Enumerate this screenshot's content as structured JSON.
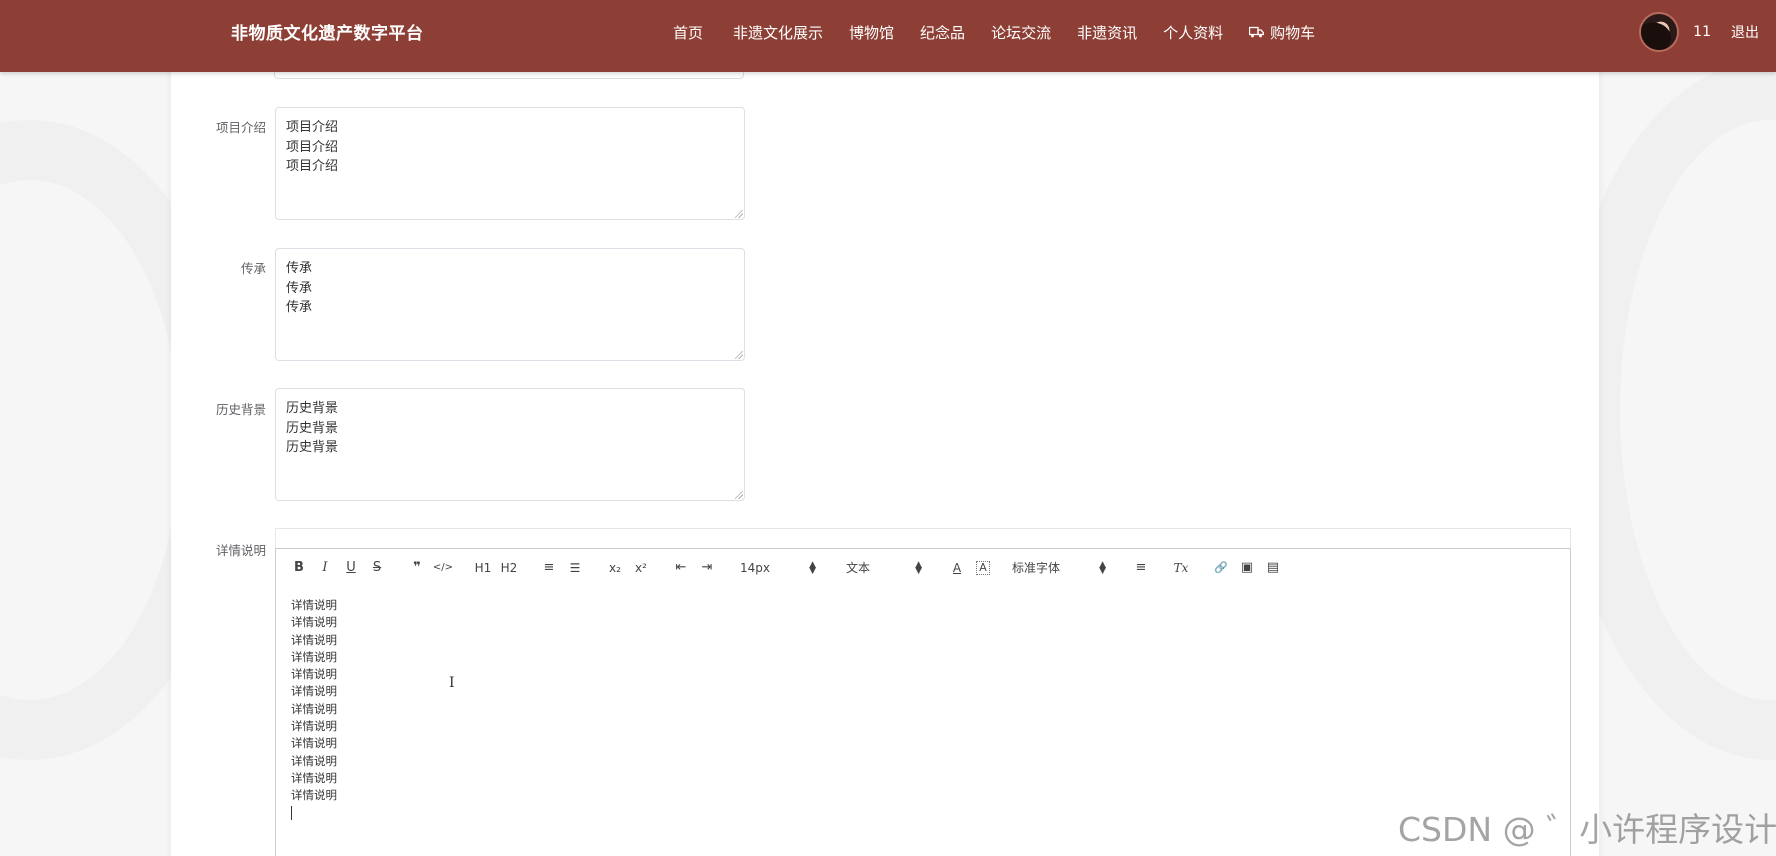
{
  "header": {
    "brand": "非物质文化遗产数字平台",
    "nav": [
      "首页",
      "非遗文化展示",
      "博物馆",
      "纪念品",
      "论坛交流",
      "非遗资讯",
      "个人资料"
    ],
    "cart_label": "购物车",
    "user_name": "11",
    "logout_label": "退出",
    "colors": {
      "bar": "#8e3f35",
      "text": "#ffffff"
    }
  },
  "form": {
    "intro": {
      "label": "项目介绍",
      "lines": [
        "项目介绍",
        "项目介绍",
        "项目介绍"
      ]
    },
    "inherit": {
      "label": "传承",
      "lines": [
        "传承",
        "传承",
        "传承"
      ]
    },
    "history": {
      "label": "历史背景",
      "lines": [
        "历史背景",
        "历史背景",
        "历史背景"
      ]
    },
    "detail": {
      "label": "详情说明",
      "lines": [
        "详情说明",
        "详情说明",
        "详情说明",
        "详情说明",
        "详情说明",
        "详情说明",
        "详情说明",
        "详情说明",
        "详情说明",
        "详情说明",
        "详情说明",
        "详情说明"
      ]
    }
  },
  "toolbar": {
    "bold": "B",
    "italic": "I",
    "underline": "U",
    "strike": "S",
    "quote": "❞",
    "code": "</>",
    "h1": "H1",
    "h2": "H2",
    "ordered_list": "≡",
    "bullet_list": "☰",
    "subscript": "x₂",
    "superscript": "x²",
    "outdent": "⇤",
    "indent": "⇥",
    "size_value": "14px",
    "header_value": "文本",
    "color": "A",
    "background": "A",
    "font_value": "标准字体",
    "align": "≡",
    "clean": "Tx",
    "link": "🔗",
    "image": "▣",
    "video": "▤"
  },
  "watermark": "CSDN @ ゛小许程序设计"
}
